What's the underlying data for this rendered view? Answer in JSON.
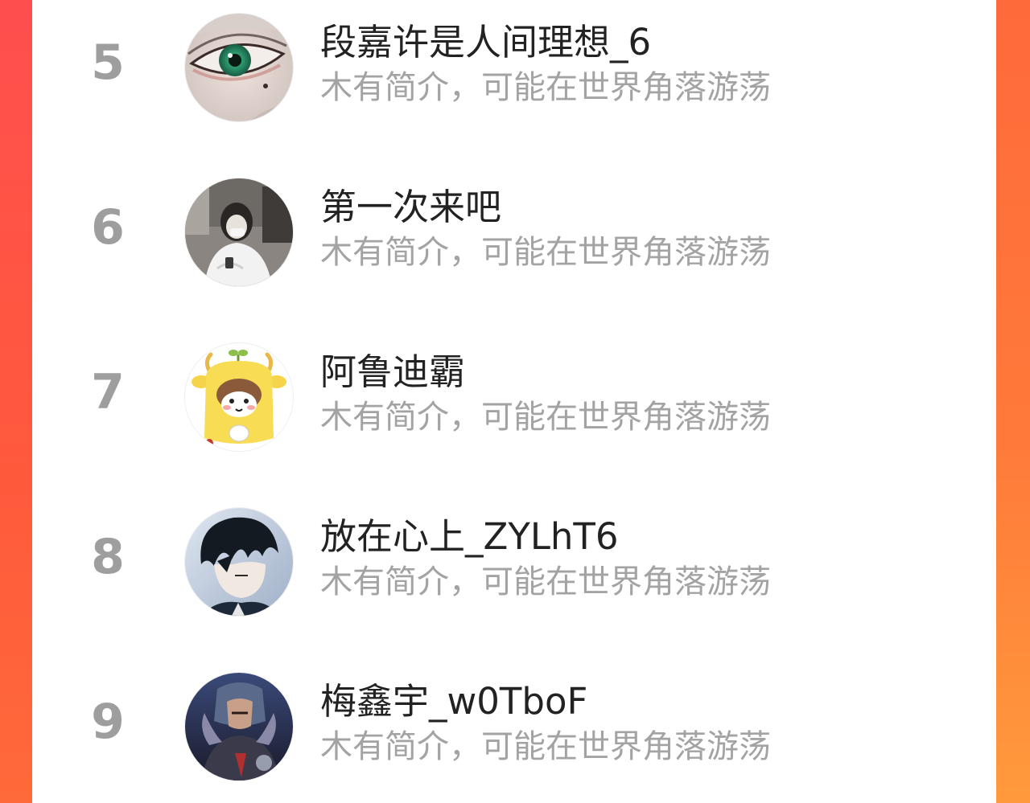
{
  "ranking": {
    "items": [
      {
        "rank": "5",
        "name": "段嘉许是人间理想_6",
        "bio": "木有简介，可能在世界角落游荡",
        "avatar_icon": "eye-portrait-avatar"
      },
      {
        "rank": "6",
        "name": "第一次来吧",
        "bio": "木有简介，可能在世界角落游荡",
        "avatar_icon": "girl-photo-avatar"
      },
      {
        "rank": "7",
        "name": "阿鲁迪霸",
        "bio": "木有简介，可能在世界角落游荡",
        "avatar_icon": "cartoon-calf-avatar"
      },
      {
        "rank": "8",
        "name": "放在心上_ZYLhT6",
        "bio": "木有简介，可能在世界角落游荡",
        "avatar_icon": "anime-boy-avatar"
      },
      {
        "rank": "9",
        "name": "梅鑫宇_w0TboF",
        "bio": "木有简介，可能在世界角落游荡",
        "avatar_icon": "game-warrior-avatar"
      }
    ]
  },
  "colors": {
    "background_gradient_top": "#ff4a4a",
    "background_gradient_bottom": "#ff8a3a",
    "panel": "#ffffff",
    "rank_text": "#9e9e9e",
    "name_text": "#222222",
    "bio_text": "#a3a3a3"
  }
}
